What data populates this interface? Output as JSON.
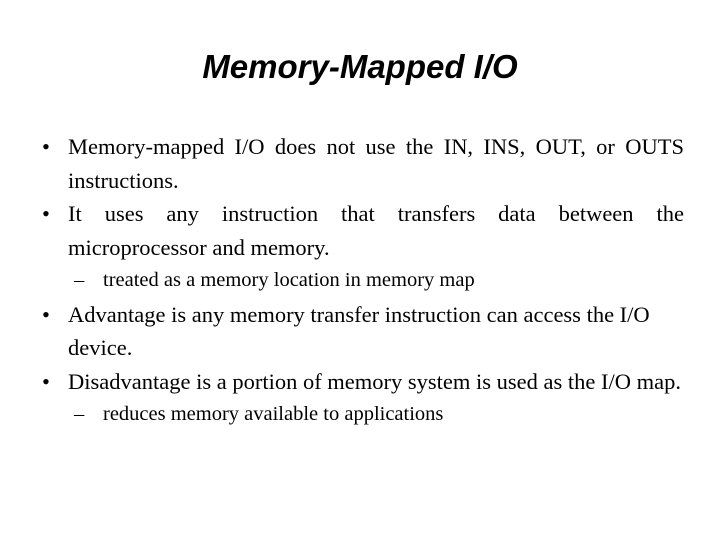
{
  "slide": {
    "title": "Memory-Mapped I/O",
    "background_color": "#ffffff",
    "text_color": "#000000",
    "bullet_marker": "•",
    "subbullet_marker": "–",
    "items": [
      {
        "level": 1,
        "text": "Memory-mapped I/O does not use the IN, INS, OUT, or OUTS instructions.",
        "justified": true
      },
      {
        "level": 1,
        "text": "It uses any instruction that transfers data between the microprocessor and memory.",
        "justified": true
      },
      {
        "level": 2,
        "text": "treated as a memory location in memory map",
        "justified": false
      },
      {
        "level": 1,
        "text": "Advantage is any memory transfer instruction can access the I/O device.",
        "justified": false
      },
      {
        "level": 1,
        "text": "Disadvantage is a portion of memory system is used as the I/O map.",
        "justified": true
      },
      {
        "level": 2,
        "text": "reduces memory available to applications",
        "justified": false
      }
    ]
  }
}
